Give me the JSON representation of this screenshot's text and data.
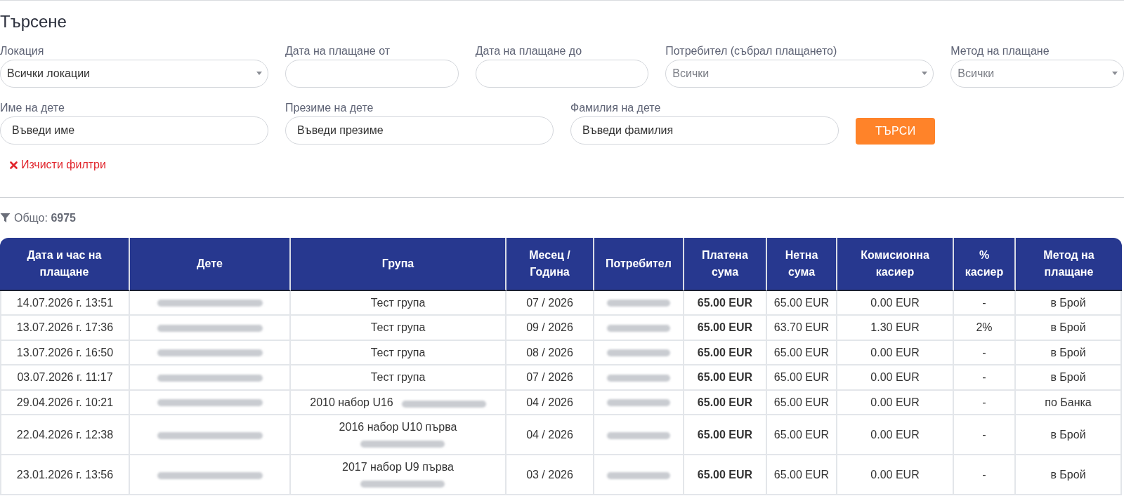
{
  "heading": "Търсене",
  "filters": [
    {
      "kind": "select",
      "label": "Локация",
      "value": "Всички локации"
    },
    {
      "kind": "date",
      "label": "Дата на плащане от"
    },
    {
      "kind": "date",
      "label": "Дата на плащане до"
    },
    {
      "kind": "select",
      "label": "Потребител (събрал плащането)",
      "placeholder": "Всички"
    },
    {
      "kind": "select",
      "label": "Метод на плащане",
      "placeholder": "Всички"
    },
    {
      "kind": "text",
      "label": "Име на дете",
      "placeholder": "Въведи име"
    },
    {
      "kind": "text",
      "label": "Презиме на дете",
      "placeholder": "Въведи презиме"
    },
    {
      "kind": "text",
      "label": "Фамилия на дете",
      "placeholder": "Въведи фамилия"
    }
  ],
  "search_button": "ТЪРСИ",
  "clear_filters": "Изчисти филтри",
  "total": {
    "label": "Общо:",
    "value": "6975"
  },
  "table": {
    "columns": [
      "Дата и час на плащане",
      "Дете",
      "Група",
      "Месец / Година",
      "Потребител",
      "Платена сума",
      "Нетна сума",
      "Комисионна касиер",
      "% касиер",
      "Метод на плащане"
    ],
    "rows": [
      {
        "date": "14.07.2026 г. 13:51",
        "child_blurred": true,
        "group": "Тест група",
        "month": "07 / 2026",
        "user_blurred": true,
        "paid": "65.00 EUR",
        "net": "65.00 EUR",
        "commission": "0.00 EUR",
        "percent": "-",
        "method": "в Брой"
      },
      {
        "date": "13.07.2026 г. 17:36",
        "child_blurred": true,
        "group": "Тест група",
        "month": "09 / 2026",
        "user_blurred": true,
        "paid": "65.00 EUR",
        "net": "63.70 EUR",
        "commission": "1.30 EUR",
        "percent": "2%",
        "method": "в Брой"
      },
      {
        "date": "13.07.2026 г. 16:50",
        "child_blurred": true,
        "group": "Тест група",
        "month": "08 / 2026",
        "user_blurred": true,
        "paid": "65.00 EUR",
        "net": "65.00 EUR",
        "commission": "0.00 EUR",
        "percent": "-",
        "method": "в Брой"
      },
      {
        "date": "03.07.2026 г. 11:17",
        "child_blurred": true,
        "group": "Тест група",
        "month": "07 / 2026",
        "user_blurred": true,
        "paid": "65.00 EUR",
        "net": "65.00 EUR",
        "commission": "0.00 EUR",
        "percent": "-",
        "method": "в Брой"
      },
      {
        "date": "29.04.2026 г. 10:21",
        "child_blurred": true,
        "group": "2010 набор U16",
        "coach_blurred": true,
        "month": "04 / 2026",
        "user_blurred": true,
        "paid": "65.00 EUR",
        "net": "65.00 EUR",
        "commission": "0.00 EUR",
        "percent": "-",
        "method": "по Банка"
      },
      {
        "date": "22.04.2026 г. 12:38",
        "child_blurred": true,
        "group": "2016 набор U10 първа",
        "coach_blurred": true,
        "month": "04 / 2026",
        "user_blurred": true,
        "paid": "65.00 EUR",
        "net": "65.00 EUR",
        "commission": "0.00 EUR",
        "percent": "-",
        "method": "в Брой"
      },
      {
        "date": "23.01.2026 г. 13:56",
        "child_blurred": true,
        "group": "2017 набор U9 първа",
        "coach_blurred": true,
        "month": "03 / 2026",
        "user_blurred": true,
        "paid": "65.00 EUR",
        "net": "65.00 EUR",
        "commission": "0.00 EUR",
        "percent": "-",
        "method": "в Брой"
      }
    ]
  }
}
